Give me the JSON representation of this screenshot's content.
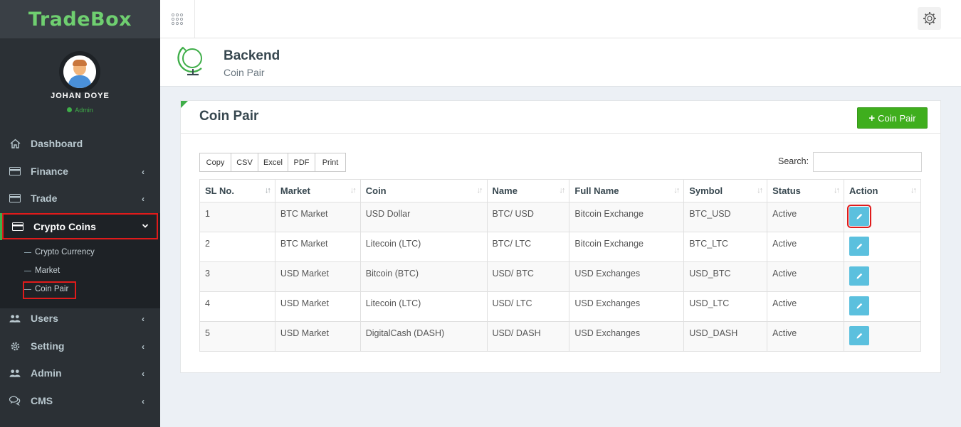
{
  "app": {
    "brand": "TradeBox"
  },
  "profile": {
    "name": "JOHAN DOYE",
    "role": "Admin"
  },
  "sidebar": {
    "items": [
      {
        "label": "Dashboard",
        "icon": "home-icon"
      },
      {
        "label": "Finance",
        "icon": "card-icon"
      },
      {
        "label": "Trade",
        "icon": "card-icon"
      },
      {
        "label": "Crypto Coins",
        "icon": "card-icon"
      },
      {
        "label": "Users",
        "icon": "users-icon"
      },
      {
        "label": "Setting",
        "icon": "gear-icon"
      },
      {
        "label": "Admin",
        "icon": "users-icon"
      },
      {
        "label": "CMS",
        "icon": "comments-icon"
      }
    ],
    "submenu": [
      "Crypto Currency",
      "Market",
      "Coin Pair"
    ]
  },
  "header": {
    "title": "Backend",
    "subtitle": "Coin Pair"
  },
  "panel": {
    "title": "Coin Pair",
    "add_button": "Coin Pair",
    "export_buttons": [
      "Copy",
      "CSV",
      "Excel",
      "PDF",
      "Print"
    ],
    "search_label": "Search:"
  },
  "table": {
    "columns": [
      "SL No.",
      "Market",
      "Coin",
      "Name",
      "Full Name",
      "Symbol",
      "Status",
      "Action"
    ],
    "rows": [
      [
        "1",
        "BTC Market",
        "USD Dollar",
        "BTC/ USD",
        "Bitcoin Exchange",
        "BTC_USD",
        "Active"
      ],
      [
        "2",
        "BTC Market",
        "Litecoin (LTC)",
        "BTC/ LTC",
        "Bitcoin Exchange",
        "BTC_LTC",
        "Active"
      ],
      [
        "3",
        "USD Market",
        "Bitcoin (BTC)",
        "USD/ BTC",
        "USD Exchanges",
        "USD_BTC",
        "Active"
      ],
      [
        "4",
        "USD Market",
        "Litecoin (LTC)",
        "USD/ LTC",
        "USD Exchanges",
        "USD_LTC",
        "Active"
      ],
      [
        "5",
        "USD Market",
        "DigitalCash (DASH)",
        "USD/ DASH",
        "USD Exchanges",
        "USD_DASH",
        "Active"
      ]
    ]
  },
  "colors": {
    "accent": "#3fae49",
    "add_button": "#3fae1d",
    "edit_button": "#5bc0de",
    "highlight": "#e01b1b"
  }
}
